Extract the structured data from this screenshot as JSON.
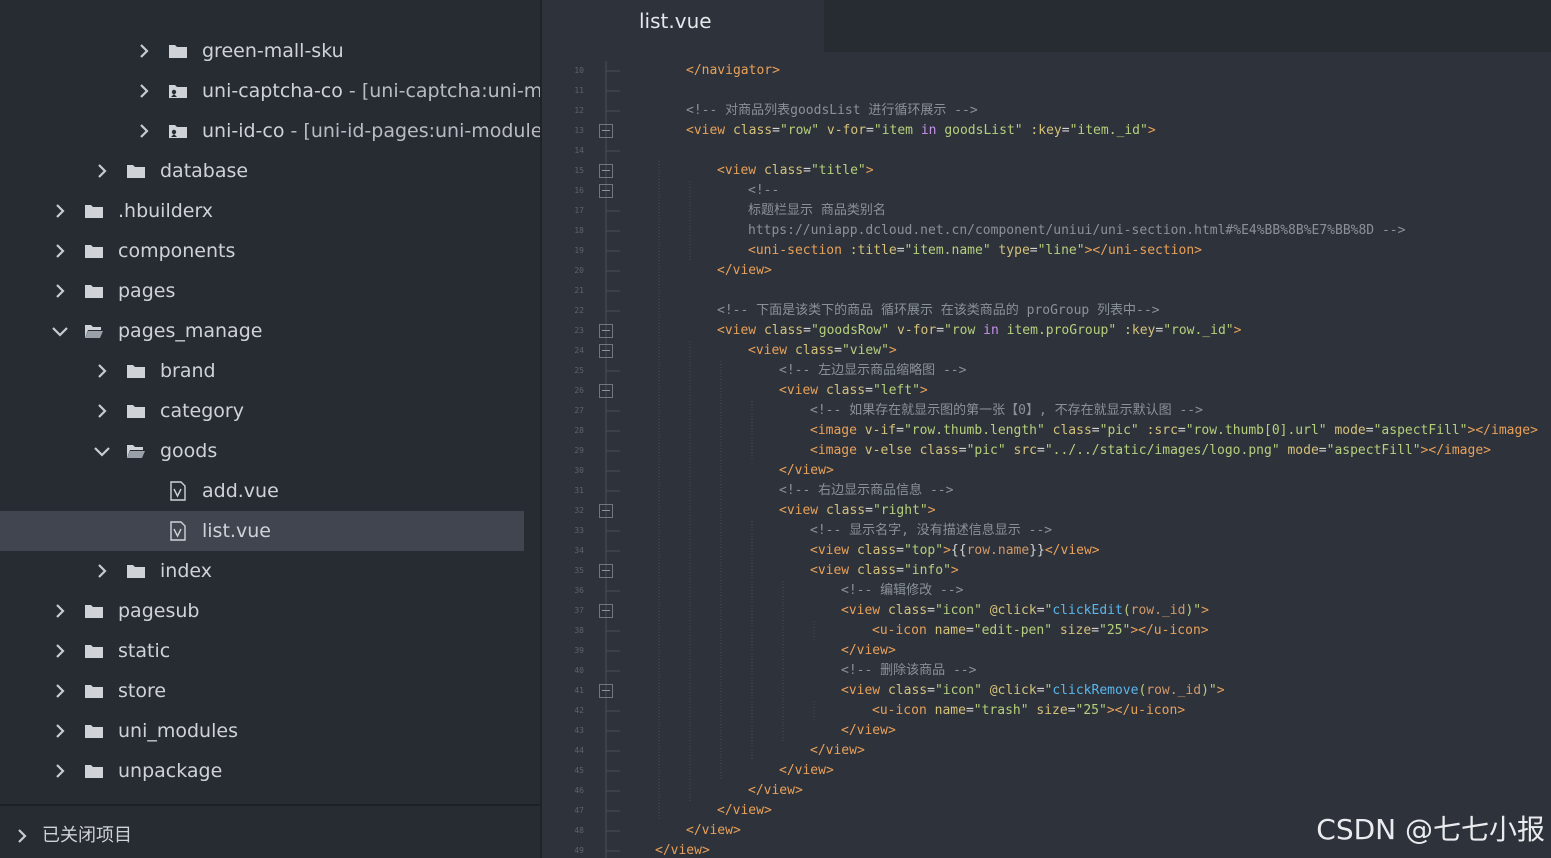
{
  "sidebar": {
    "items": [
      {
        "label": "green-mall-sku",
        "annotation": "",
        "level": 3,
        "type": "folder",
        "expanded": false,
        "selected": false
      },
      {
        "label": "uni-captcha-co",
        "annotation": " - [uni-captcha:uni-mc",
        "level": 3,
        "type": "cloud-folder",
        "expanded": false,
        "selected": false
      },
      {
        "label": "uni-id-co",
        "annotation": " - [uni-id-pages:uni-module",
        "level": 3,
        "type": "cloud-folder",
        "expanded": false,
        "selected": false
      },
      {
        "label": "database",
        "annotation": "",
        "level": 2,
        "type": "folder",
        "expanded": false,
        "selected": false
      },
      {
        "label": ".hbuilderx",
        "annotation": "",
        "level": 1,
        "type": "folder",
        "expanded": false,
        "selected": false
      },
      {
        "label": "components",
        "annotation": "",
        "level": 1,
        "type": "folder",
        "expanded": false,
        "selected": false
      },
      {
        "label": "pages",
        "annotation": "",
        "level": 1,
        "type": "folder",
        "expanded": false,
        "selected": false
      },
      {
        "label": "pages_manage",
        "annotation": "",
        "level": 1,
        "type": "folder",
        "expanded": true,
        "selected": false
      },
      {
        "label": "brand",
        "annotation": "",
        "level": 2,
        "type": "folder",
        "expanded": false,
        "selected": false
      },
      {
        "label": "category",
        "annotation": "",
        "level": 2,
        "type": "folder",
        "expanded": false,
        "selected": false
      },
      {
        "label": "goods",
        "annotation": "",
        "level": 2,
        "type": "folder",
        "expanded": true,
        "selected": false
      },
      {
        "label": "add.vue",
        "annotation": "",
        "level": 3,
        "type": "vue-file",
        "expanded": false,
        "selected": false
      },
      {
        "label": "list.vue",
        "annotation": "",
        "level": 3,
        "type": "vue-file",
        "expanded": false,
        "selected": true
      },
      {
        "label": "index",
        "annotation": "",
        "level": 2,
        "type": "folder",
        "expanded": false,
        "selected": false
      },
      {
        "label": "pagesub",
        "annotation": "",
        "level": 1,
        "type": "folder",
        "expanded": false,
        "selected": false
      },
      {
        "label": "static",
        "annotation": "",
        "level": 1,
        "type": "folder",
        "expanded": false,
        "selected": false
      },
      {
        "label": "store",
        "annotation": "",
        "level": 1,
        "type": "folder",
        "expanded": false,
        "selected": false
      },
      {
        "label": "uni_modules",
        "annotation": "",
        "level": 1,
        "type": "folder",
        "expanded": false,
        "selected": false
      },
      {
        "label": "unpackage",
        "annotation": "",
        "level": 1,
        "type": "folder",
        "expanded": false,
        "selected": false
      }
    ],
    "closed_projects_label": "已关闭项目"
  },
  "editor": {
    "tab_label": "list.vue",
    "lines": [
      {
        "num": "10",
        "indent": 1,
        "fold": false,
        "tokens": [
          [
            "tag",
            "</navigator>"
          ]
        ]
      },
      {
        "num": "11",
        "indent": 0,
        "fold": false,
        "tokens": []
      },
      {
        "num": "12",
        "indent": 1,
        "fold": false,
        "tokens": [
          [
            "com",
            "<!-- 对商品列表goodsList 进行循环展示 -->"
          ]
        ]
      },
      {
        "num": "13",
        "indent": 1,
        "fold": true,
        "tokens": [
          [
            "tag",
            "<view "
          ],
          [
            "attr",
            "class"
          ],
          [
            "txt",
            "="
          ],
          [
            "str",
            "\"row\""
          ],
          [
            "txt",
            " "
          ],
          [
            "attr",
            "v-for"
          ],
          [
            "txt",
            "="
          ],
          [
            "str",
            "\"item "
          ],
          [
            "kw",
            "in"
          ],
          [
            "str",
            " goodsList\""
          ],
          [
            "txt",
            " "
          ],
          [
            "attr",
            ":key"
          ],
          [
            "txt",
            "="
          ],
          [
            "str",
            "\"item._id\""
          ],
          [
            "tag",
            ">"
          ]
        ]
      },
      {
        "num": "14",
        "indent": 0,
        "fold": false,
        "tokens": []
      },
      {
        "num": "15",
        "indent": 2,
        "fold": true,
        "tokens": [
          [
            "tag",
            "<view "
          ],
          [
            "attr",
            "class"
          ],
          [
            "txt",
            "="
          ],
          [
            "str",
            "\"title\""
          ],
          [
            "tag",
            ">"
          ]
        ]
      },
      {
        "num": "16",
        "indent": 3,
        "fold": true,
        "tokens": [
          [
            "com",
            "<!--"
          ]
        ]
      },
      {
        "num": "17",
        "indent": 3,
        "fold": false,
        "tokens": [
          [
            "com",
            "标题栏显示 商品类别名"
          ]
        ]
      },
      {
        "num": "18",
        "indent": 3,
        "fold": false,
        "tokens": [
          [
            "com",
            "https://uniapp.dcloud.net.cn/component/uniui/uni-section.html#%E4%BB%8B%E7%BB%8D -->"
          ]
        ]
      },
      {
        "num": "19",
        "indent": 3,
        "fold": false,
        "tokens": [
          [
            "tag",
            "<uni-section "
          ],
          [
            "attr",
            ":title"
          ],
          [
            "txt",
            "="
          ],
          [
            "str",
            "\"item.name\""
          ],
          [
            "txt",
            " "
          ],
          [
            "attr",
            "type"
          ],
          [
            "txt",
            "="
          ],
          [
            "str",
            "\"line\""
          ],
          [
            "tag",
            "></uni-section>"
          ]
        ]
      },
      {
        "num": "20",
        "indent": 2,
        "fold": false,
        "tokens": [
          [
            "tag",
            "</view>"
          ]
        ]
      },
      {
        "num": "21",
        "indent": 0,
        "fold": false,
        "tokens": []
      },
      {
        "num": "22",
        "indent": 2,
        "fold": false,
        "tokens": [
          [
            "com",
            "<!-- 下面是该类下的商品 循环展示 在该类商品的 proGroup 列表中-->"
          ]
        ]
      },
      {
        "num": "23",
        "indent": 2,
        "fold": true,
        "tokens": [
          [
            "tag",
            "<view "
          ],
          [
            "attr",
            "class"
          ],
          [
            "txt",
            "="
          ],
          [
            "str",
            "\"goodsRow\""
          ],
          [
            "txt",
            " "
          ],
          [
            "attr",
            "v-for"
          ],
          [
            "txt",
            "="
          ],
          [
            "str",
            "\"row "
          ],
          [
            "kw",
            "in"
          ],
          [
            "str",
            " item.proGroup\""
          ],
          [
            "txt",
            " "
          ],
          [
            "attr",
            ":key"
          ],
          [
            "txt",
            "="
          ],
          [
            "str",
            "\"row._id\""
          ],
          [
            "tag",
            ">"
          ]
        ]
      },
      {
        "num": "24",
        "indent": 3,
        "fold": true,
        "tokens": [
          [
            "tag",
            "<view "
          ],
          [
            "attr",
            "class"
          ],
          [
            "txt",
            "="
          ],
          [
            "str",
            "\"view\""
          ],
          [
            "tag",
            ">"
          ]
        ]
      },
      {
        "num": "25",
        "indent": 4,
        "fold": false,
        "tokens": [
          [
            "com",
            "<!-- 左边显示商品缩略图 -->"
          ]
        ]
      },
      {
        "num": "26",
        "indent": 4,
        "fold": true,
        "tokens": [
          [
            "tag",
            "<view "
          ],
          [
            "attr",
            "class"
          ],
          [
            "txt",
            "="
          ],
          [
            "str",
            "\"left\""
          ],
          [
            "tag",
            ">"
          ]
        ]
      },
      {
        "num": "27",
        "indent": 5,
        "fold": false,
        "tokens": [
          [
            "com",
            "<!-- 如果存在就显示图的第一张【0】, 不存在就显示默认图 -->"
          ]
        ]
      },
      {
        "num": "28",
        "indent": 5,
        "fold": false,
        "tokens": [
          [
            "tag",
            "<image "
          ],
          [
            "attr",
            "v-if"
          ],
          [
            "txt",
            "="
          ],
          [
            "str",
            "\"row.thumb.length\""
          ],
          [
            "txt",
            " "
          ],
          [
            "attr",
            "class"
          ],
          [
            "txt",
            "="
          ],
          [
            "str",
            "\"pic\""
          ],
          [
            "txt",
            " "
          ],
          [
            "attr",
            ":src"
          ],
          [
            "txt",
            "="
          ],
          [
            "str",
            "\"row.thumb[0].url\""
          ],
          [
            "txt",
            " "
          ],
          [
            "attr",
            "mode"
          ],
          [
            "txt",
            "="
          ],
          [
            "str",
            "\"aspectFill\""
          ],
          [
            "tag",
            "></image>"
          ]
        ]
      },
      {
        "num": "29",
        "indent": 5,
        "fold": false,
        "tokens": [
          [
            "tag",
            "<image "
          ],
          [
            "attr",
            "v-else"
          ],
          [
            "txt",
            " "
          ],
          [
            "attr",
            "class"
          ],
          [
            "txt",
            "="
          ],
          [
            "str",
            "\"pic\""
          ],
          [
            "txt",
            " "
          ],
          [
            "attr",
            "src"
          ],
          [
            "txt",
            "="
          ],
          [
            "str",
            "\"../../static/images/logo.png\""
          ],
          [
            "txt",
            " "
          ],
          [
            "attr",
            "mode"
          ],
          [
            "txt",
            "="
          ],
          [
            "str",
            "\"aspectFill\""
          ],
          [
            "tag",
            "></image>"
          ]
        ]
      },
      {
        "num": "30",
        "indent": 4,
        "fold": false,
        "tokens": [
          [
            "tag",
            "</view>"
          ]
        ]
      },
      {
        "num": "31",
        "indent": 4,
        "fold": false,
        "tokens": [
          [
            "com",
            "<!-- 右边显示商品信息 -->"
          ]
        ]
      },
      {
        "num": "32",
        "indent": 4,
        "fold": true,
        "tokens": [
          [
            "tag",
            "<view "
          ],
          [
            "attr",
            "class"
          ],
          [
            "txt",
            "="
          ],
          [
            "str",
            "\"right\""
          ],
          [
            "tag",
            ">"
          ]
        ]
      },
      {
        "num": "33",
        "indent": 5,
        "fold": false,
        "tokens": [
          [
            "com",
            "<!-- 显示名字, 没有描述信息显示 -->"
          ]
        ]
      },
      {
        "num": "34",
        "indent": 5,
        "fold": false,
        "tokens": [
          [
            "tag",
            "<view "
          ],
          [
            "attr",
            "class"
          ],
          [
            "txt",
            "="
          ],
          [
            "str",
            "\"top\""
          ],
          [
            "tag",
            ">"
          ],
          [
            "txt",
            "{{"
          ],
          [
            "var",
            "row.name"
          ],
          [
            "txt",
            "}}"
          ],
          [
            "tag",
            "</view>"
          ]
        ]
      },
      {
        "num": "35",
        "indent": 5,
        "fold": true,
        "tokens": [
          [
            "tag",
            "<view "
          ],
          [
            "attr",
            "class"
          ],
          [
            "txt",
            "="
          ],
          [
            "str",
            "\"info\""
          ],
          [
            "tag",
            ">"
          ]
        ]
      },
      {
        "num": "36",
        "indent": 6,
        "fold": false,
        "tokens": [
          [
            "com",
            "<!-- 编辑修改 -->"
          ]
        ]
      },
      {
        "num": "37",
        "indent": 6,
        "fold": true,
        "tokens": [
          [
            "tag",
            "<view "
          ],
          [
            "attr",
            "class"
          ],
          [
            "txt",
            "="
          ],
          [
            "str",
            "\"icon\""
          ],
          [
            "txt",
            " "
          ],
          [
            "attr",
            "@click"
          ],
          [
            "txt",
            "="
          ],
          [
            "str",
            "\""
          ],
          [
            "fn",
            "clickEdit"
          ],
          [
            "str",
            "("
          ],
          [
            "var",
            "row._id"
          ],
          [
            "str",
            ")\""
          ],
          [
            "tag",
            ">"
          ]
        ]
      },
      {
        "num": "38",
        "indent": 7,
        "fold": false,
        "tokens": [
          [
            "tag",
            "<u-icon "
          ],
          [
            "attr",
            "name"
          ],
          [
            "txt",
            "="
          ],
          [
            "str",
            "\"edit-pen\""
          ],
          [
            "txt",
            " "
          ],
          [
            "attr",
            "size"
          ],
          [
            "txt",
            "="
          ],
          [
            "str",
            "\"25\""
          ],
          [
            "tag",
            "></u-icon>"
          ]
        ]
      },
      {
        "num": "39",
        "indent": 6,
        "fold": false,
        "tokens": [
          [
            "tag",
            "</view>"
          ]
        ]
      },
      {
        "num": "40",
        "indent": 6,
        "fold": false,
        "tokens": [
          [
            "com",
            "<!-- 删除该商品 -->"
          ]
        ]
      },
      {
        "num": "41",
        "indent": 6,
        "fold": true,
        "tokens": [
          [
            "tag",
            "<view "
          ],
          [
            "attr",
            "class"
          ],
          [
            "txt",
            "="
          ],
          [
            "str",
            "\"icon\""
          ],
          [
            "txt",
            " "
          ],
          [
            "attr",
            "@click"
          ],
          [
            "txt",
            "="
          ],
          [
            "str",
            "\""
          ],
          [
            "fn",
            "clickRemove"
          ],
          [
            "str",
            "("
          ],
          [
            "var",
            "row._id"
          ],
          [
            "str",
            ")\""
          ],
          [
            "tag",
            ">"
          ]
        ]
      },
      {
        "num": "42",
        "indent": 7,
        "fold": false,
        "tokens": [
          [
            "tag",
            "<u-icon "
          ],
          [
            "attr",
            "name"
          ],
          [
            "txt",
            "="
          ],
          [
            "str",
            "\"trash\""
          ],
          [
            "txt",
            " "
          ],
          [
            "attr",
            "size"
          ],
          [
            "txt",
            "="
          ],
          [
            "str",
            "\"25\""
          ],
          [
            "tag",
            "></u-icon>"
          ]
        ]
      },
      {
        "num": "43",
        "indent": 6,
        "fold": false,
        "tokens": [
          [
            "tag",
            "</view>"
          ]
        ]
      },
      {
        "num": "44",
        "indent": 5,
        "fold": false,
        "tokens": [
          [
            "tag",
            "</view>"
          ]
        ]
      },
      {
        "num": "45",
        "indent": 4,
        "fold": false,
        "tokens": [
          [
            "tag",
            "</view>"
          ]
        ]
      },
      {
        "num": "46",
        "indent": 3,
        "fold": false,
        "tokens": [
          [
            "tag",
            "</view>"
          ]
        ]
      },
      {
        "num": "47",
        "indent": 2,
        "fold": false,
        "tokens": [
          [
            "tag",
            "</view>"
          ]
        ]
      },
      {
        "num": "48",
        "indent": 1,
        "fold": false,
        "tokens": [
          [
            "tag",
            "</view>"
          ]
        ]
      },
      {
        "num": "49",
        "indent": 0,
        "fold": false,
        "tokens": [
          [
            "tag",
            "</view>"
          ]
        ]
      }
    ]
  },
  "watermark": "CSDN @七七小报",
  "colors": {
    "sidebar_bg": "#272b32",
    "selected_row": "#404550",
    "editor_bg": "#2e323a",
    "tag": "#e8a15a",
    "attribute": "#d4c17a",
    "string": "#b6cf7d",
    "comment": "#8b919a",
    "keyword": "#c792ea",
    "function": "#59b6ec"
  }
}
